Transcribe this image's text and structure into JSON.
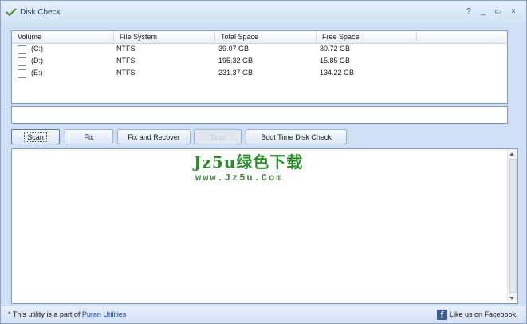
{
  "window": {
    "title": "Disk Check",
    "controls": [
      "?",
      "_",
      "▭",
      "×"
    ]
  },
  "list": {
    "columns": [
      "Volume",
      "File System",
      "Total Space",
      "Free Space"
    ],
    "rows": [
      {
        "volume": "(C:)",
        "fs": "NTFS",
        "total": "39.07 GB",
        "free": "30.72 GB"
      },
      {
        "volume": "(D:)",
        "fs": "NTFS",
        "total": "195.32 GB",
        "free": "15.85 GB"
      },
      {
        "volume": "(E:)",
        "fs": "NTFS",
        "total": "231.37 GB",
        "free": "134.22 GB"
      }
    ]
  },
  "path_input": {
    "value": ""
  },
  "buttons": {
    "scan": "Scan",
    "fix": "Fix",
    "fix_recover": "Fix and Recover",
    "stop": "Stop",
    "boot_check": "Boot Time Disk Check"
  },
  "watermark": {
    "line1": "Jz5u绿色下载",
    "line2": "www.Jz5u.Com"
  },
  "status": {
    "text": "* This utility is a part of",
    "link": "Puran Utilities",
    "facebook": "Like us on Facebook."
  },
  "colors": {
    "accent": "#3b5998",
    "watermark": "#2e8b2e"
  }
}
